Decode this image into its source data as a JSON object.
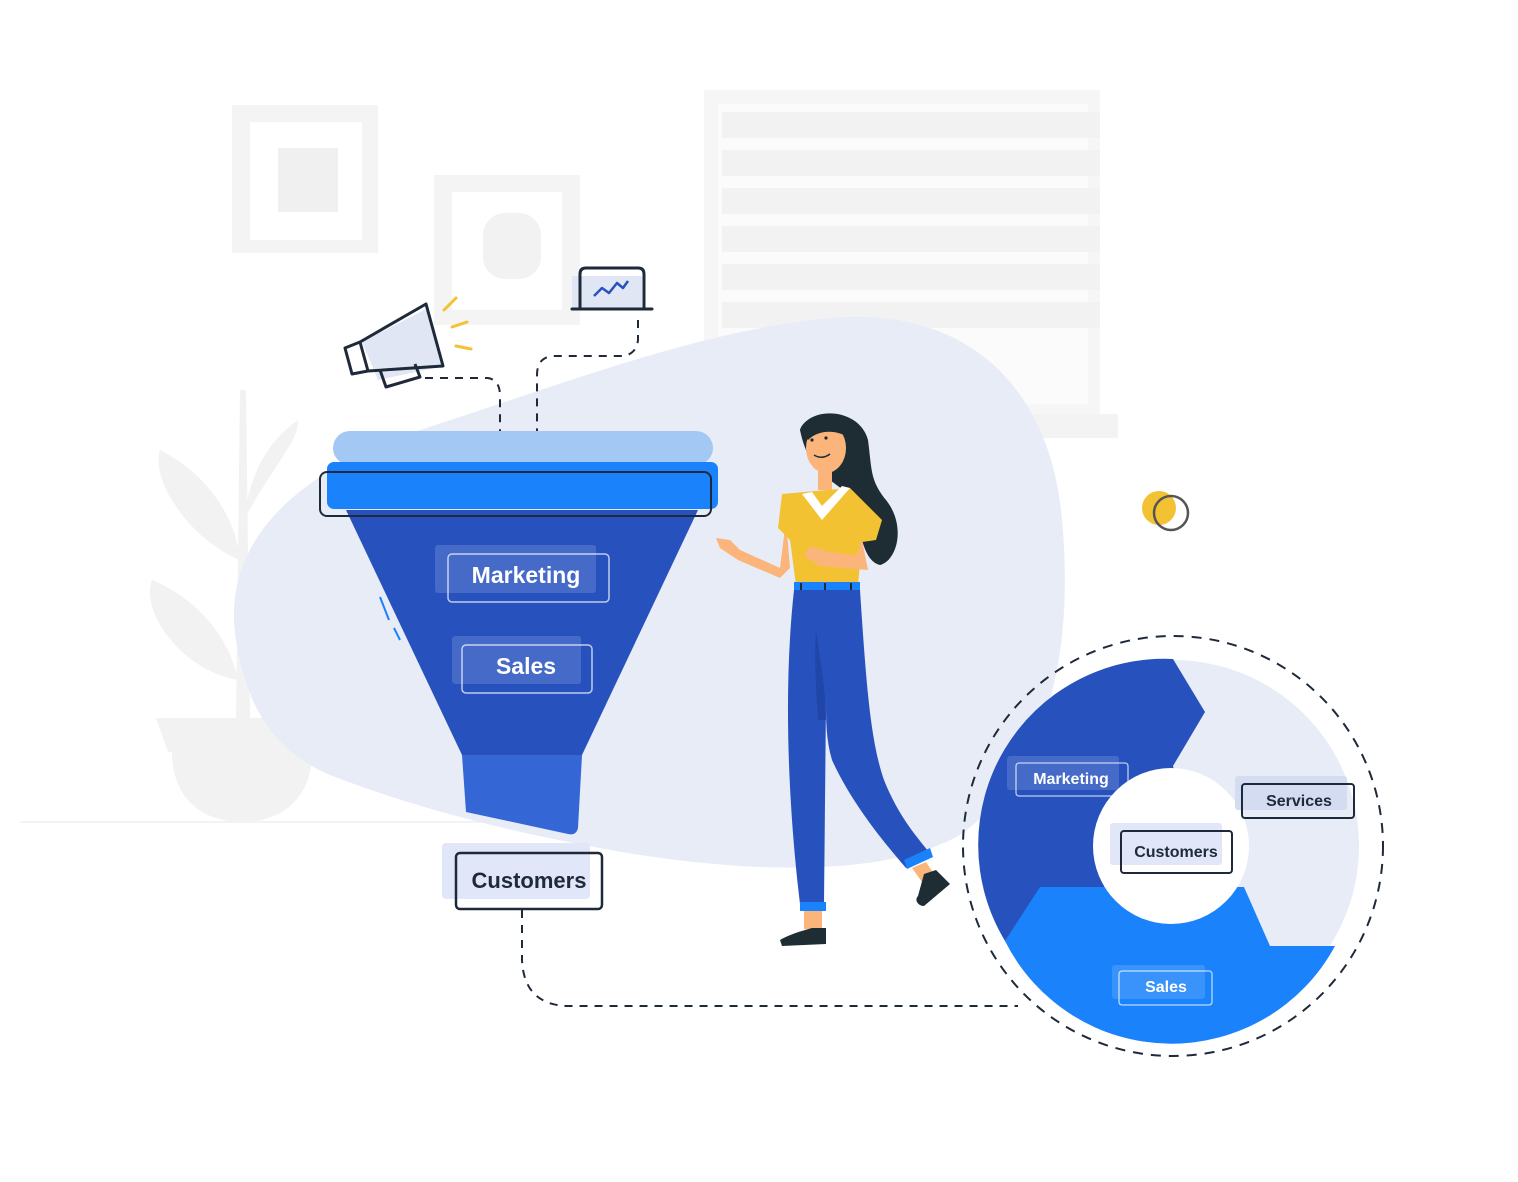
{
  "scene": {
    "title": "Sales funnel illustration",
    "colors": {
      "funnel_dark": "#2752BE",
      "funnel_light": "#1A82FB",
      "funnel_rim": "#A3C8F4",
      "funnel_spout": "#3566D6",
      "blob": "#E8ECF7",
      "outline": "#1E2A3A",
      "accent_yellow": "#F3C233",
      "skin": "#FBB57A",
      "hair": "#1E2D33",
      "wall": "#F5F5F5"
    }
  },
  "funnel": {
    "stages": [
      {
        "label": "Marketing"
      },
      {
        "label": "Sales"
      }
    ],
    "output_label": "Customers",
    "inputs": [
      {
        "icon": "megaphone-icon"
      },
      {
        "icon": "laptop-chart-icon"
      }
    ]
  },
  "cycle": {
    "center_label": "Customers",
    "segments": [
      {
        "label": "Marketing",
        "color": "#2752BE"
      },
      {
        "label": "Services",
        "color": "#E8ECF7"
      },
      {
        "label": "Sales",
        "color": "#1A82FB"
      }
    ]
  }
}
